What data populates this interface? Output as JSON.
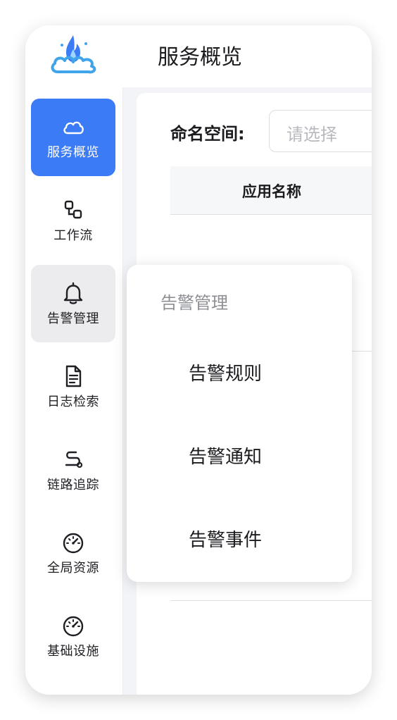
{
  "sidebar": {
    "logo_icon": "flame-cloud-logo",
    "accent_color": "#3b7bf5",
    "items": [
      {
        "label": "服务概览",
        "icon": "cloud-icon"
      },
      {
        "label": "工作流",
        "icon": "workflow-icon"
      },
      {
        "label": "告警管理",
        "icon": "bell-icon"
      },
      {
        "label": "日志检索",
        "icon": "document-icon"
      },
      {
        "label": "链路追踪",
        "icon": "route-icon"
      },
      {
        "label": "全局资源",
        "icon": "gauge-icon"
      },
      {
        "label": "基础设施",
        "icon": "gauge-icon"
      }
    ]
  },
  "header": {
    "title": "服务概览"
  },
  "filter": {
    "label": "命名空间:",
    "placeholder": "请选择"
  },
  "table": {
    "columns": [
      "应用名称"
    ]
  },
  "dropdown": {
    "title": "告警管理",
    "items": [
      "告警规则",
      "告警通知",
      "告警事件"
    ]
  }
}
